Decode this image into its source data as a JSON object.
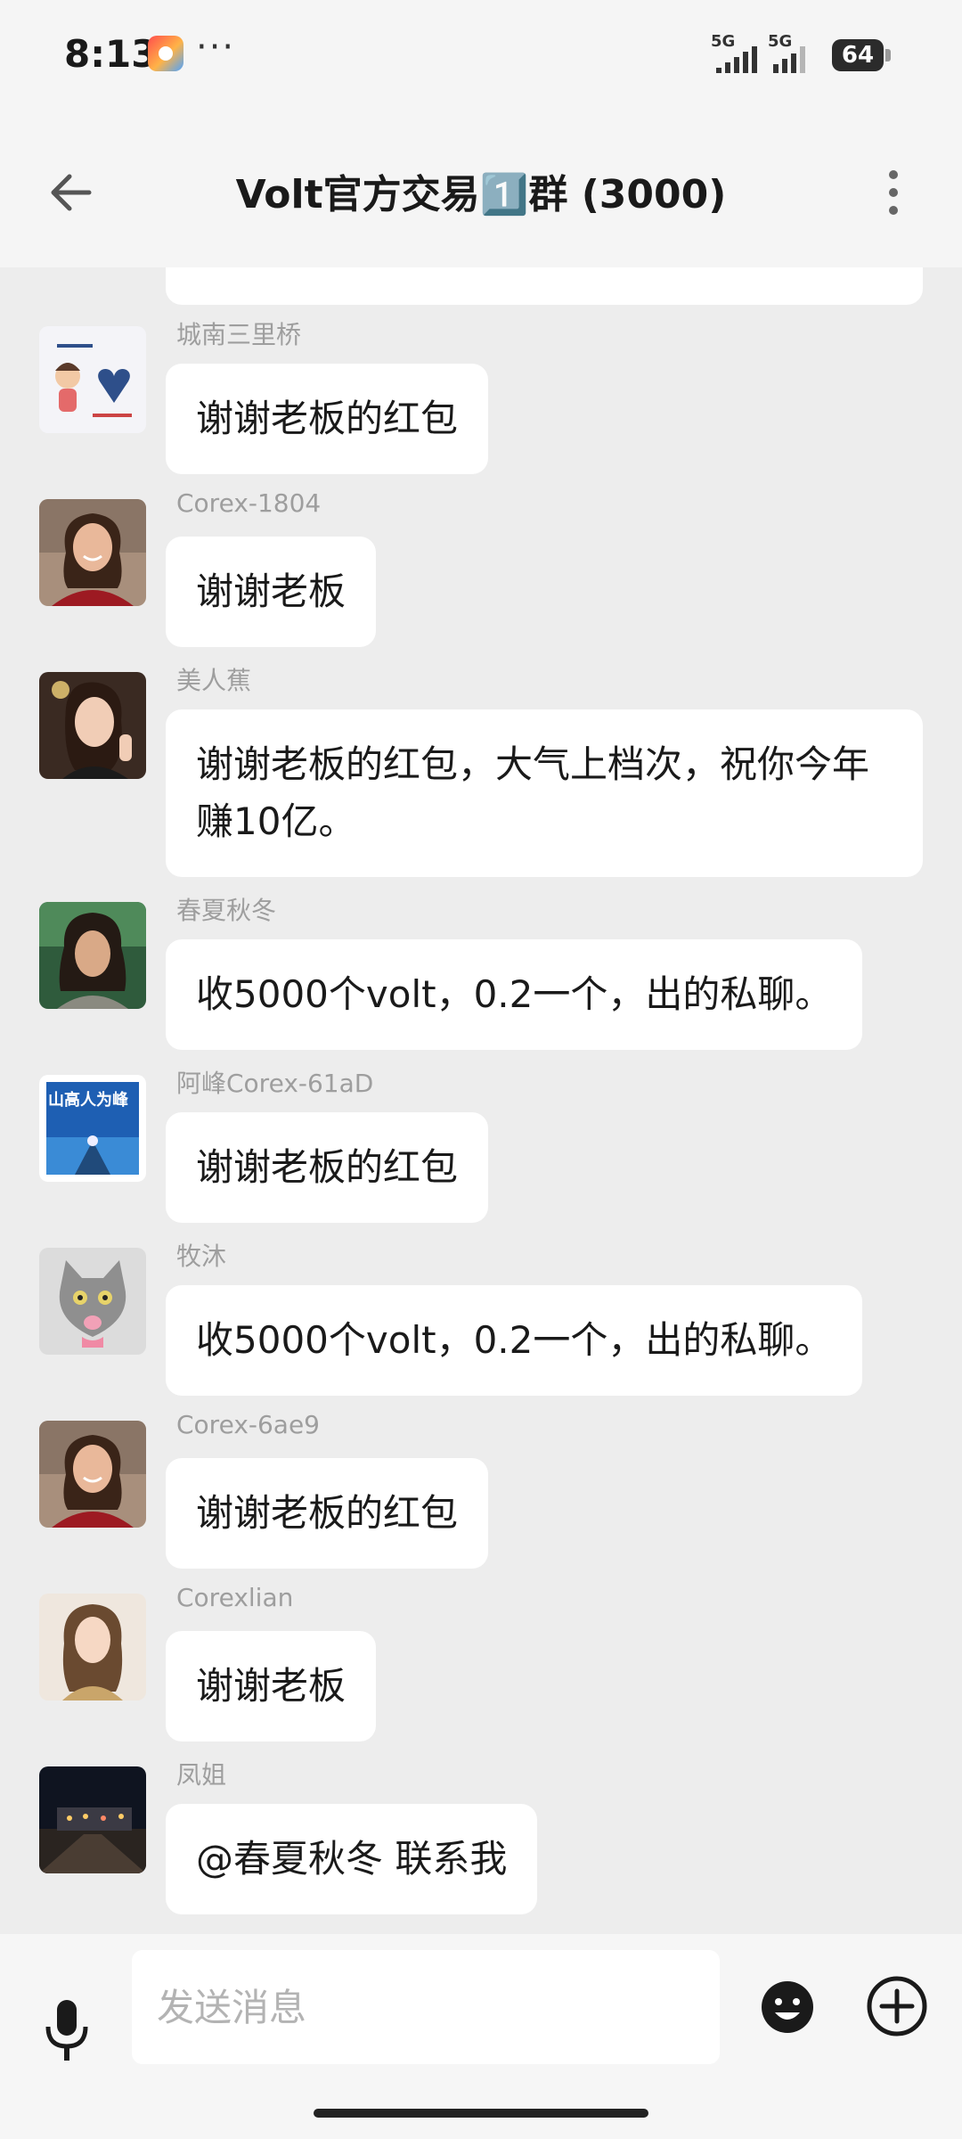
{
  "status_bar": {
    "time": "8:13",
    "dots": "···",
    "signal1_label": "5G",
    "signal2_label": "5G",
    "battery": "64"
  },
  "header": {
    "title": "Volt官方交易1️⃣群 (3000)",
    "back_icon": "arrow-left-icon",
    "more_icon": "more-vertical-icon"
  },
  "messages": [
    {
      "sender": "城南三里桥",
      "text": "谢谢老板的红包"
    },
    {
      "sender": "Corex-1804",
      "text": "谢谢老板"
    },
    {
      "sender": "美人蕉",
      "text": "谢谢老板的红包，大气上档次，祝你今年赚10亿。"
    },
    {
      "sender": "春夏秋冬",
      "text": "收5000个volt，0.2一个，出的私聊。"
    },
    {
      "sender": "阿峰Corex-61aD",
      "text": "谢谢老板的红包",
      "avatar_caption": "山高人为峰"
    },
    {
      "sender": "牧沐",
      "text": "收5000个volt，0.2一个，出的私聊。"
    },
    {
      "sender": "Corex-6ae9",
      "text": "谢谢老板的红包"
    },
    {
      "sender": "Corexlian",
      "text": "谢谢老板"
    },
    {
      "sender": "凤姐",
      "text": "@春夏秋冬 联系我"
    }
  ],
  "input_bar": {
    "placeholder": "发送消息",
    "mic_icon": "microphone-icon",
    "emoji_icon": "emoji-icon",
    "plus_icon": "plus-circle-icon"
  }
}
